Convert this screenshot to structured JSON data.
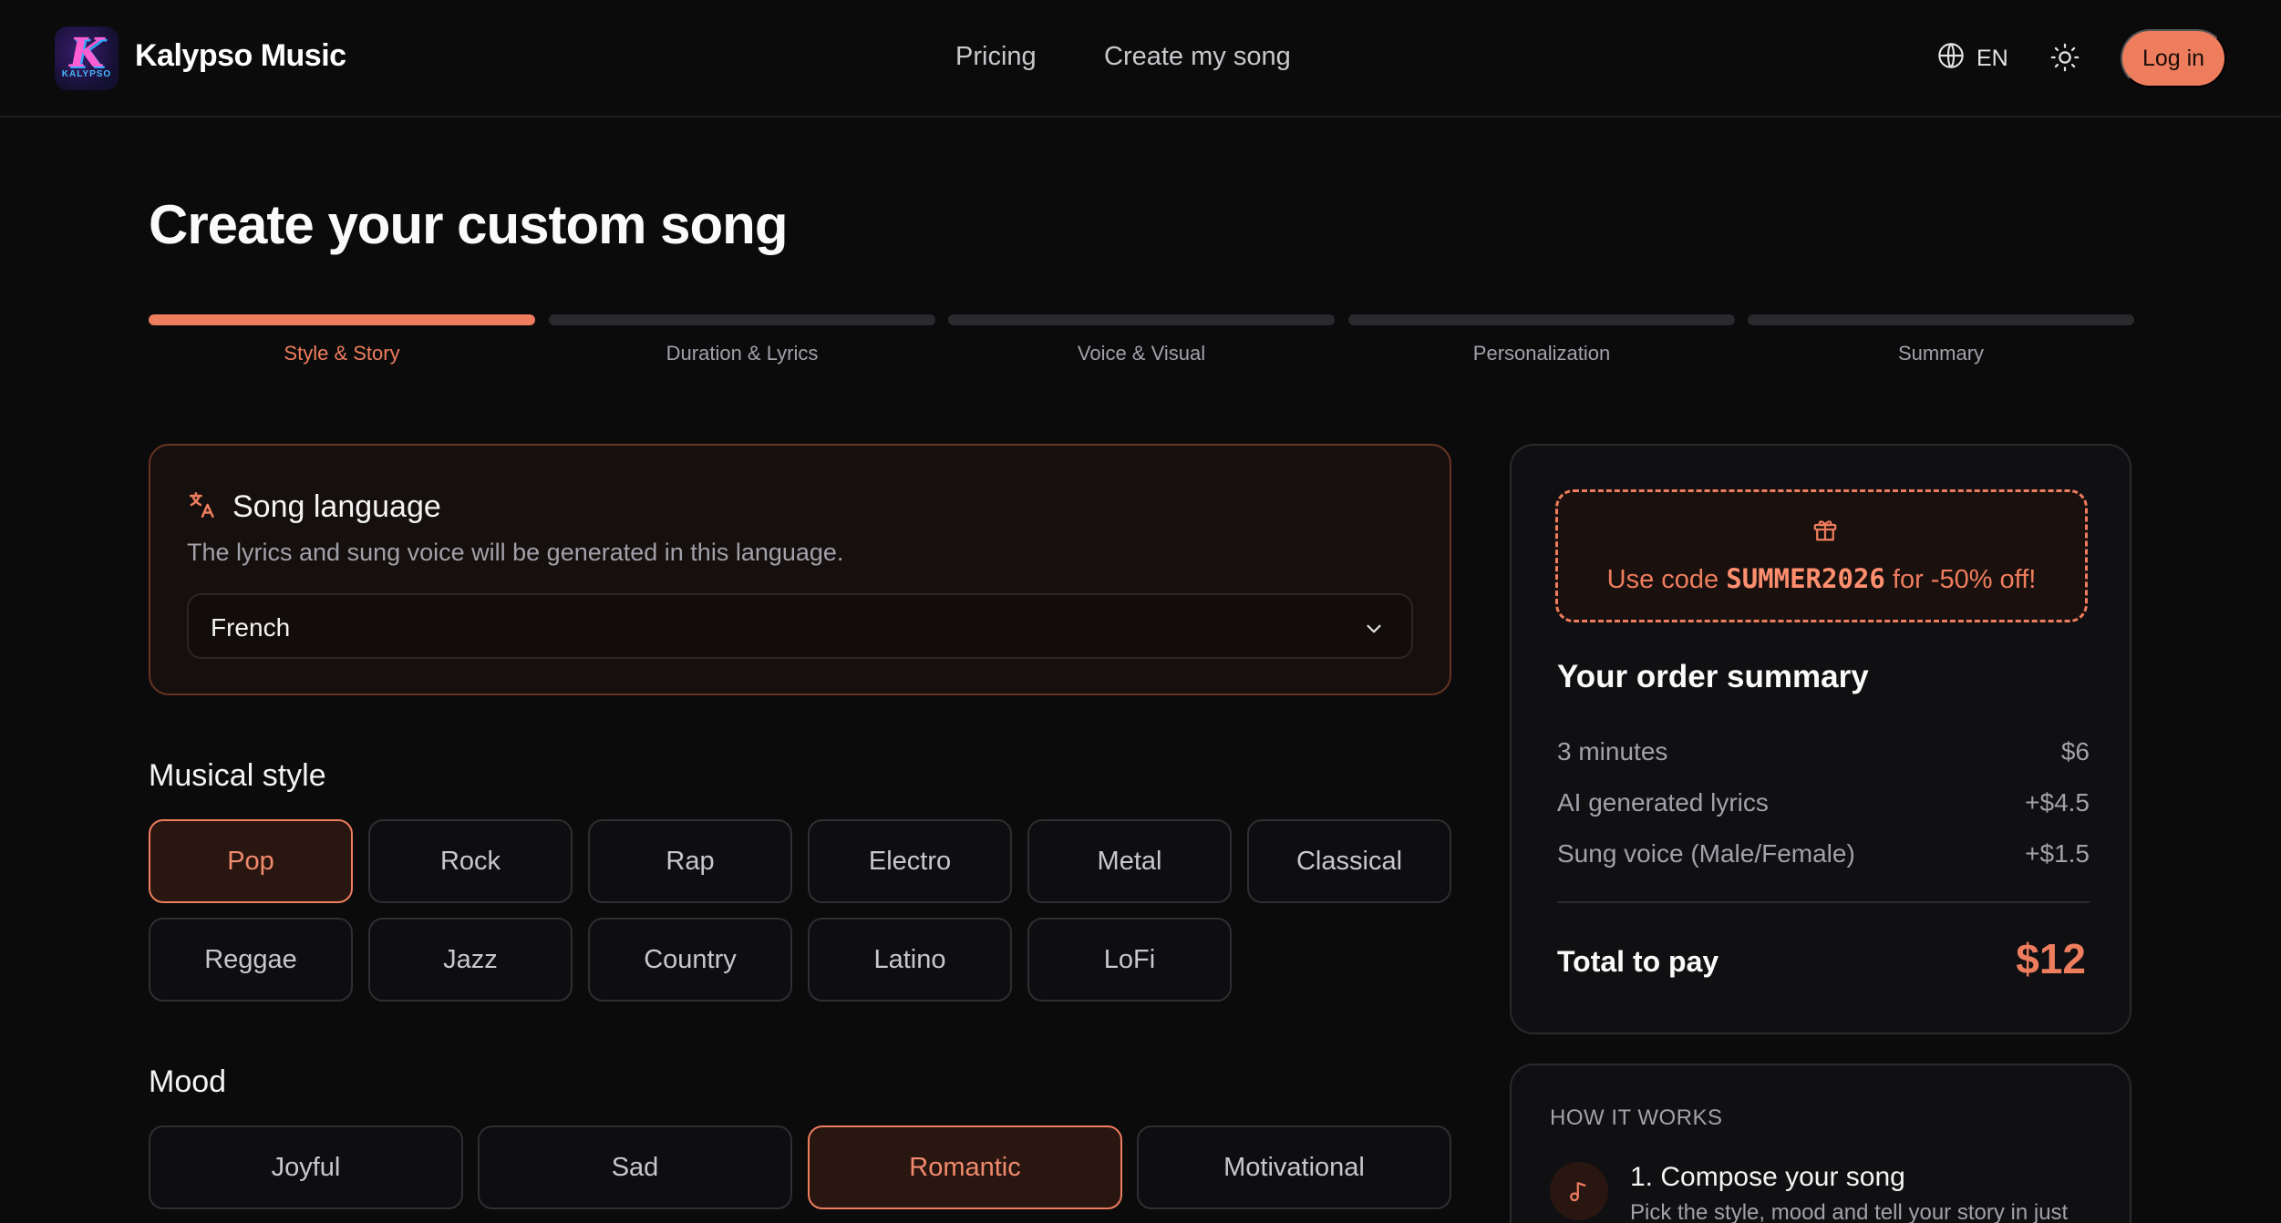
{
  "header": {
    "brand": "Kalypso Music",
    "logo_text": "KALYPSO",
    "nav": [
      {
        "label": "Pricing"
      },
      {
        "label": "Create my song"
      }
    ],
    "language": "EN",
    "login_label": "Log in"
  },
  "page": {
    "title": "Create your custom song"
  },
  "stepper": {
    "steps": [
      {
        "label": "Style & Story",
        "active": true
      },
      {
        "label": "Duration & Lyrics",
        "active": false
      },
      {
        "label": "Voice & Visual",
        "active": false
      },
      {
        "label": "Personalization",
        "active": false
      },
      {
        "label": "Summary",
        "active": false
      }
    ]
  },
  "language_card": {
    "title": "Song language",
    "description": "The lyrics and sung voice will be generated in this language.",
    "selected": "French"
  },
  "musical_style": {
    "title": "Musical style",
    "options": [
      "Pop",
      "Rock",
      "Rap",
      "Electro",
      "Metal",
      "Classical",
      "Reggae",
      "Jazz",
      "Country",
      "Latino",
      "LoFi"
    ],
    "selected": "Pop"
  },
  "mood": {
    "title": "Mood",
    "options": [
      "Joyful",
      "Sad",
      "Romantic",
      "Motivational"
    ],
    "selected": "Romantic"
  },
  "promo": {
    "prefix": "Use code ",
    "code": "SUMMER2026",
    "suffix": " for -50% off!"
  },
  "order_summary": {
    "title": "Your order summary",
    "lines": [
      {
        "label": "3 minutes",
        "price": "$6"
      },
      {
        "label": "AI generated lyrics",
        "price": "+$4.5"
      },
      {
        "label": "Sung voice (Male/Female)",
        "price": "+$1.5"
      }
    ],
    "total_label": "Total to pay",
    "total_value": "$12"
  },
  "how_it_works": {
    "title": "HOW IT WORKS",
    "step_title": "1. Compose your song",
    "step_desc": "Pick the style, mood and tell your story in just"
  },
  "colors": {
    "accent": "#ee7d5e",
    "background": "#0b0b0c"
  },
  "icons": [
    "globe-icon",
    "sun-icon",
    "translate-icon",
    "chevron-down-icon",
    "gift-icon",
    "music-note-icon"
  ]
}
